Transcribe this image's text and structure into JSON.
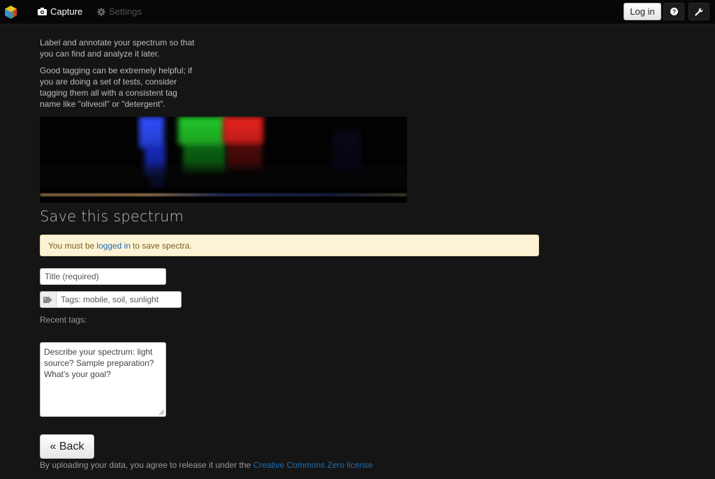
{
  "navbar": {
    "logo_icon": "cube-logo-icon",
    "capture_label": "Capture",
    "capture_icon": "camera-icon",
    "settings_label": "Settings",
    "settings_icon": "gear-icon",
    "login_label": "Log in",
    "help_icon": "question-icon",
    "tools_icon": "wrench-icon"
  },
  "intro": {
    "paragraph1": "Label and annotate your spectrum so that you can find and analyze it later.",
    "paragraph2": "Good tagging can be extremely helpful; if you are doing a set of tests, consider tagging them all with a consistent tag name like \"oliveoil\" or \"detergent\"."
  },
  "save": {
    "heading": "Save this spectrum",
    "alert_prefix": "You must be",
    "alert_link": "logged in",
    "alert_suffix": "to save spectra."
  },
  "form": {
    "title_placeholder": "Title (required)",
    "tags_placeholder": "Tags: mobile, soil, sunlight",
    "tags_icon": "tags-icon",
    "recent_tags_label": "Recent tags:",
    "description_placeholder": "Describe your spectrum: light source? Sample preparation? What's your goal?"
  },
  "actions": {
    "back_label": "« Back"
  },
  "footer": {
    "text": "By uploading your data, you agree to release it under the",
    "license_link": "Creative Commons Zero license"
  },
  "colors": {
    "background": "#151515",
    "navbar": "#070707",
    "alert_bg": "#fcf3d6",
    "link": "#1f6fb2"
  }
}
